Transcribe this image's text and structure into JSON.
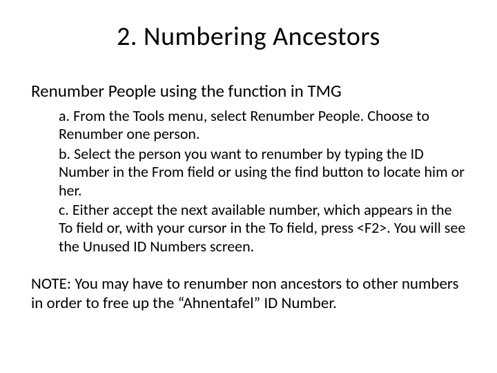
{
  "title": "2. Numbering Ancestors",
  "subtitle": "Renumber People using the function in TMG",
  "steps": {
    "a": "a. From the Tools menu, select Renumber People. Choose to Renumber one person.",
    "b": "b. Select the person you want to renumber by typing the ID Number in the From field or using the find button to locate him or her.",
    "c": "c. Either accept the next available number, which appears in the To field or, with your cursor in the To field, press <F2>. You will see the Unused ID Numbers screen."
  },
  "note": "NOTE: You may have to renumber non ancestors to other numbers in order to free up the “Ahnentafel” ID Number."
}
